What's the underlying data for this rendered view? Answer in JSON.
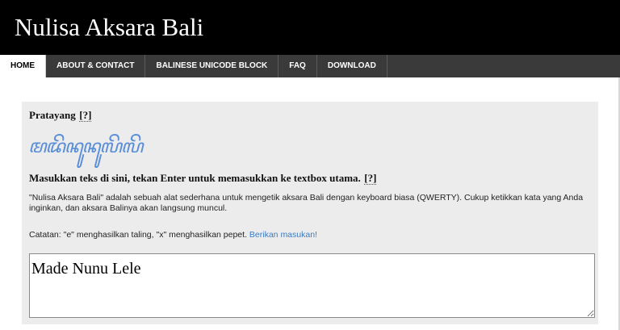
{
  "header": {
    "title": "Nulisa Aksara Bali"
  },
  "nav": {
    "items": [
      {
        "label": "HOME",
        "active": true
      },
      {
        "label": "ABOUT & CONTACT",
        "active": false
      },
      {
        "label": "BALINESE UNICODE BLOCK",
        "active": false
      },
      {
        "label": "FAQ",
        "active": false
      },
      {
        "label": "DOWNLOAD",
        "active": false
      }
    ]
  },
  "preview": {
    "label": "Pratayang",
    "help": "[?]",
    "script_text": "ꦩꦢꦼꦤꦸꦤꦸꦭꦼꦭꦼ"
  },
  "input_section": {
    "instruction": "Masukkan teks di sini, tekan Enter untuk memasukkan ke textbox utama.",
    "help": "[?]"
  },
  "description": {
    "paragraph": "\"Nulisa Aksara Bali\" adalah sebuah alat sederhana untuk mengetik aksara Bali dengan keyboard biasa (QWERTY). Cukup ketikkan kata yang Anda inginkan, dan aksara Balinya akan langsung muncul.",
    "note_prefix": "Catatan: \"e\" menghasilkan taling, \"x\" menghasilkan pepet.",
    "note_link": "Berikan masukan!"
  },
  "textbox": {
    "value": "Made Nunu Lele"
  },
  "colors": {
    "header_bg": "#000000",
    "nav_bg": "#3a3a3a",
    "panel_bg": "#ececec",
    "script_color": "#5b8fd8",
    "link_color": "#3a7cc4"
  }
}
